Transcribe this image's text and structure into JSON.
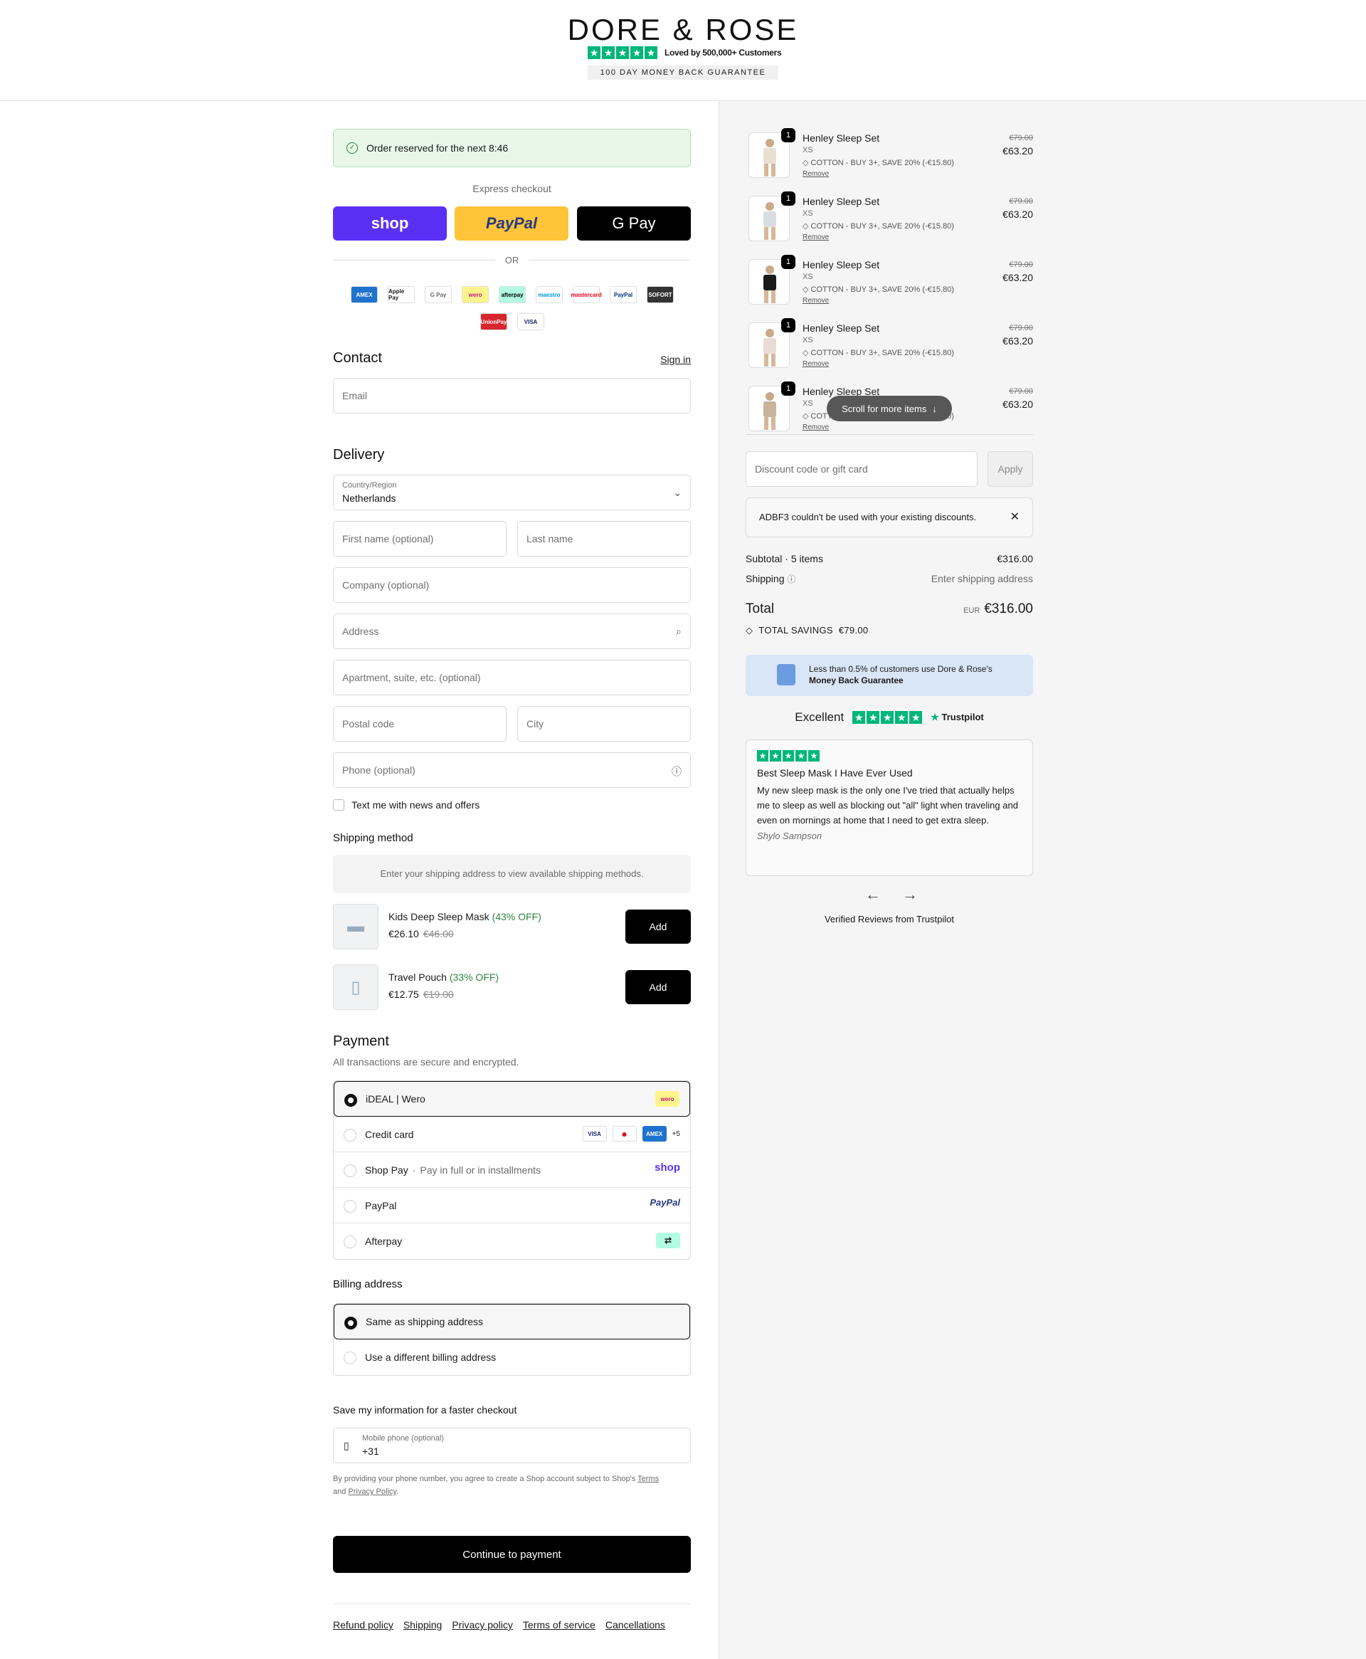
{
  "header": {
    "logo": "DORE & ROSE",
    "loved": "Loved by 500,000+ Customers",
    "guarantee": "100 DAY MONEY BACK GUARANTEE"
  },
  "reserve": {
    "text": "Order reserved for the next 8:46"
  },
  "express": {
    "title": "Express checkout",
    "shop": "shop",
    "paypal": "PayPal",
    "gpay": "G Pay",
    "or": "OR"
  },
  "pay_icons": [
    "AMEX",
    "Apple Pay",
    "G Pay",
    "wero",
    "afterpay",
    "maestro",
    "mastercard",
    "PayPal",
    "SOFORT",
    "UnionPay",
    "VISA"
  ],
  "contact": {
    "title": "Contact",
    "sign_in": "Sign in",
    "email_placeholder": "Email"
  },
  "delivery": {
    "title": "Delivery",
    "country_label": "Country/Region",
    "country_value": "Netherlands",
    "first_name": "First name (optional)",
    "last_name": "Last name",
    "company": "Company (optional)",
    "address": "Address",
    "apartment": "Apartment, suite, etc. (optional)",
    "postal": "Postal code",
    "city": "City",
    "phone": "Phone (optional)",
    "text_me": "Text me with news and offers"
  },
  "shipping": {
    "title": "Shipping method",
    "info": "Enter your shipping address to view available shipping methods."
  },
  "upsells": [
    {
      "name": "Kids Deep Sleep Mask",
      "off": "(43% OFF)",
      "price": "€26.10",
      "old": "€46.00",
      "button": "Add"
    },
    {
      "name": "Travel Pouch",
      "off": "(33% OFF)",
      "price": "€12.75",
      "old": "€19.00",
      "button": "Add"
    }
  ],
  "payment": {
    "title": "Payment",
    "desc": "All transactions are secure and encrypted.",
    "options": [
      {
        "label": "iDEAL | Wero",
        "sub": ""
      },
      {
        "label": "Credit card",
        "sub": "",
        "more": "+5"
      },
      {
        "label": "Shop Pay",
        "sub": "Pay in full or in installments"
      },
      {
        "label": "PayPal",
        "sub": ""
      },
      {
        "label": "Afterpay",
        "sub": ""
      }
    ],
    "logos": {
      "shop": "shop",
      "paypal": "PayPal",
      "visa": "VISA",
      "amex": "AMEX",
      "wero": "wero"
    }
  },
  "billing": {
    "title": "Billing address",
    "same": "Same as shipping address",
    "different": "Use a different billing address"
  },
  "save_info": {
    "title": "Save my information for a faster checkout",
    "phone_label": "Mobile phone (optional)",
    "phone_value": "+31",
    "legal_pre": "By providing your phone number, you agree to create a Shop account subject to Shop's",
    "terms": "Terms",
    "and": "and",
    "privacy": "Privacy Policy",
    "dot": "."
  },
  "continue": "Continue to payment",
  "footer": [
    "Refund policy",
    "Shipping",
    "Privacy policy",
    "Terms of service",
    "Cancellations"
  ],
  "cart": {
    "items": [
      {
        "qty": "1",
        "title": "Henley Sleep Set",
        "variant": "XS",
        "promo": "COTTON - BUY 3+, SAVE 20% (-€15.80)",
        "remove": "Remove",
        "was": "€79.00",
        "now": "€63.20",
        "color": "#e9dfcf"
      },
      {
        "qty": "1",
        "title": "Henley Sleep Set",
        "variant": "XS",
        "promo": "COTTON - BUY 3+, SAVE 20% (-€15.80)",
        "remove": "Remove",
        "was": "€79.00",
        "now": "€63.20",
        "color": "#d9dde2"
      },
      {
        "qty": "1",
        "title": "Henley Sleep Set",
        "variant": "XS",
        "promo": "COTTON - BUY 3+, SAVE 20% (-€15.80)",
        "remove": "Remove",
        "was": "€79.00",
        "now": "€63.20",
        "color": "#1a1a1a"
      },
      {
        "qty": "1",
        "title": "Henley Sleep Set",
        "variant": "XS",
        "promo": "COTTON - BUY 3+, SAVE 20% (-€15.80)",
        "remove": "Remove",
        "was": "€79.00",
        "now": "€63.20",
        "color": "#eadbd6"
      },
      {
        "qty": "1",
        "title": "Henley Sleep Set",
        "variant": "XS",
        "promo": "COTTON - BUY 3+, SAVE 20% (-€15.80)",
        "remove": "Remove",
        "was": "€79.00",
        "now": "€63.20",
        "color": "#c7b49a"
      }
    ],
    "scroll": "Scroll for more items"
  },
  "discount": {
    "placeholder": "Discount code or gift card",
    "apply": "Apply",
    "error": "ADBF3 couldn't be used with your existing discounts."
  },
  "totals": {
    "subtotal_label": "Subtotal · 5 items",
    "subtotal": "€316.00",
    "shipping_label": "Shipping",
    "shipping": "Enter shipping address",
    "total_label": "Total",
    "currency": "EUR",
    "total": "€316.00",
    "savings_label": "TOTAL SAVINGS",
    "savings": "€79.00"
  },
  "guarantee_box": {
    "line1": "Less than 0.5% of customers use Dore & Rose's",
    "line2": "Money Back Guarantee"
  },
  "trustpilot": {
    "excellent": "Excellent",
    "logo": "Trustpilot"
  },
  "review": {
    "title": "Best Sleep Mask I Have Ever Used",
    "body": "My new sleep mask is the only one I've tried that actually helps me to sleep as well as blocking out \"all\" light when traveling and even on mornings at home that I need to get extra sleep.",
    "author": "Shylo Sampson"
  },
  "verified": "Verified Reviews from Trustpilot",
  "colors": {
    "shop": "#5a31f4",
    "paypal": "#ffc439",
    "trustpilot": "#00b67a"
  }
}
